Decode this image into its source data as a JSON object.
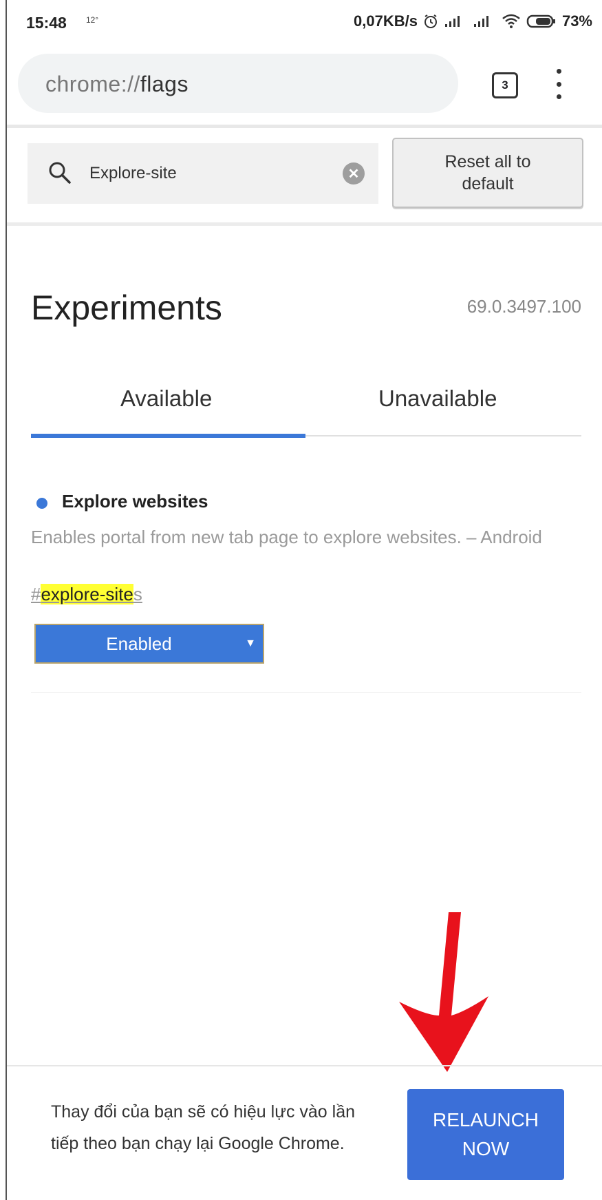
{
  "status_bar": {
    "time": "15:48",
    "temp": "12°",
    "net_speed": "0,07KB/s",
    "battery": "73%"
  },
  "omnibox": {
    "url_prefix": "chrome://",
    "url_path": "flags",
    "tab_count": "3"
  },
  "search": {
    "value": "Explore-site",
    "reset_label_line1": "Reset all to",
    "reset_label_line2": "default"
  },
  "header": {
    "title": "Experiments",
    "version": "69.0.3497.100"
  },
  "tabs": [
    {
      "label": "Available",
      "active": true
    },
    {
      "label": "Unavailable",
      "active": false
    }
  ],
  "flag": {
    "title": "Explore websites",
    "description": "Enables portal from new tab page to explore websites. – Android",
    "link_prefix": "#",
    "link_highlight": "explore-site",
    "link_suffix": "s",
    "selected": "Enabled"
  },
  "relaunch": {
    "message_line1": "Thay đổi của bạn sẽ có hiệu lực vào lần",
    "message_line2": "tiếp theo bạn chạy lại Google Chrome.",
    "button_line1": "RELAUNCH",
    "button_line2": "NOW"
  },
  "colors": {
    "accent": "#3b78d8",
    "highlight": "#ffff33",
    "annotation_arrow": "#e8121c"
  }
}
